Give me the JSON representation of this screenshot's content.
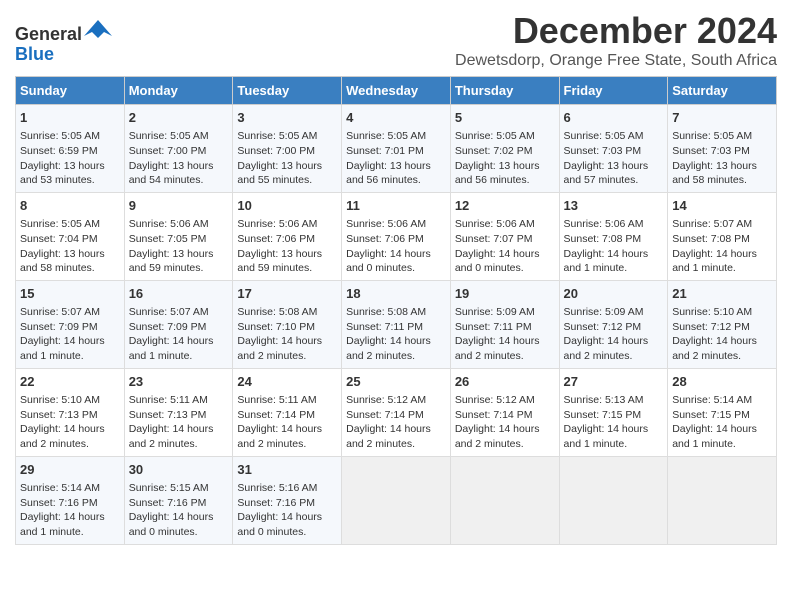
{
  "logo": {
    "line1": "General",
    "line2": "Blue"
  },
  "title": "December 2024",
  "location": "Dewetsdorp, Orange Free State, South Africa",
  "days_of_week": [
    "Sunday",
    "Monday",
    "Tuesday",
    "Wednesday",
    "Thursday",
    "Friday",
    "Saturday"
  ],
  "weeks": [
    [
      {
        "day": "1",
        "lines": [
          "Sunrise: 5:05 AM",
          "Sunset: 6:59 PM",
          "Daylight: 13 hours",
          "and 53 minutes."
        ]
      },
      {
        "day": "2",
        "lines": [
          "Sunrise: 5:05 AM",
          "Sunset: 7:00 PM",
          "Daylight: 13 hours",
          "and 54 minutes."
        ]
      },
      {
        "day": "3",
        "lines": [
          "Sunrise: 5:05 AM",
          "Sunset: 7:00 PM",
          "Daylight: 13 hours",
          "and 55 minutes."
        ]
      },
      {
        "day": "4",
        "lines": [
          "Sunrise: 5:05 AM",
          "Sunset: 7:01 PM",
          "Daylight: 13 hours",
          "and 56 minutes."
        ]
      },
      {
        "day": "5",
        "lines": [
          "Sunrise: 5:05 AM",
          "Sunset: 7:02 PM",
          "Daylight: 13 hours",
          "and 56 minutes."
        ]
      },
      {
        "day": "6",
        "lines": [
          "Sunrise: 5:05 AM",
          "Sunset: 7:03 PM",
          "Daylight: 13 hours",
          "and 57 minutes."
        ]
      },
      {
        "day": "7",
        "lines": [
          "Sunrise: 5:05 AM",
          "Sunset: 7:03 PM",
          "Daylight: 13 hours",
          "and 58 minutes."
        ]
      }
    ],
    [
      {
        "day": "8",
        "lines": [
          "Sunrise: 5:05 AM",
          "Sunset: 7:04 PM",
          "Daylight: 13 hours",
          "and 58 minutes."
        ]
      },
      {
        "day": "9",
        "lines": [
          "Sunrise: 5:06 AM",
          "Sunset: 7:05 PM",
          "Daylight: 13 hours",
          "and 59 minutes."
        ]
      },
      {
        "day": "10",
        "lines": [
          "Sunrise: 5:06 AM",
          "Sunset: 7:06 PM",
          "Daylight: 13 hours",
          "and 59 minutes."
        ]
      },
      {
        "day": "11",
        "lines": [
          "Sunrise: 5:06 AM",
          "Sunset: 7:06 PM",
          "Daylight: 14 hours",
          "and 0 minutes."
        ]
      },
      {
        "day": "12",
        "lines": [
          "Sunrise: 5:06 AM",
          "Sunset: 7:07 PM",
          "Daylight: 14 hours",
          "and 0 minutes."
        ]
      },
      {
        "day": "13",
        "lines": [
          "Sunrise: 5:06 AM",
          "Sunset: 7:08 PM",
          "Daylight: 14 hours",
          "and 1 minute."
        ]
      },
      {
        "day": "14",
        "lines": [
          "Sunrise: 5:07 AM",
          "Sunset: 7:08 PM",
          "Daylight: 14 hours",
          "and 1 minute."
        ]
      }
    ],
    [
      {
        "day": "15",
        "lines": [
          "Sunrise: 5:07 AM",
          "Sunset: 7:09 PM",
          "Daylight: 14 hours",
          "and 1 minute."
        ]
      },
      {
        "day": "16",
        "lines": [
          "Sunrise: 5:07 AM",
          "Sunset: 7:09 PM",
          "Daylight: 14 hours",
          "and 1 minute."
        ]
      },
      {
        "day": "17",
        "lines": [
          "Sunrise: 5:08 AM",
          "Sunset: 7:10 PM",
          "Daylight: 14 hours",
          "and 2 minutes."
        ]
      },
      {
        "day": "18",
        "lines": [
          "Sunrise: 5:08 AM",
          "Sunset: 7:11 PM",
          "Daylight: 14 hours",
          "and 2 minutes."
        ]
      },
      {
        "day": "19",
        "lines": [
          "Sunrise: 5:09 AM",
          "Sunset: 7:11 PM",
          "Daylight: 14 hours",
          "and 2 minutes."
        ]
      },
      {
        "day": "20",
        "lines": [
          "Sunrise: 5:09 AM",
          "Sunset: 7:12 PM",
          "Daylight: 14 hours",
          "and 2 minutes."
        ]
      },
      {
        "day": "21",
        "lines": [
          "Sunrise: 5:10 AM",
          "Sunset: 7:12 PM",
          "Daylight: 14 hours",
          "and 2 minutes."
        ]
      }
    ],
    [
      {
        "day": "22",
        "lines": [
          "Sunrise: 5:10 AM",
          "Sunset: 7:13 PM",
          "Daylight: 14 hours",
          "and 2 minutes."
        ]
      },
      {
        "day": "23",
        "lines": [
          "Sunrise: 5:11 AM",
          "Sunset: 7:13 PM",
          "Daylight: 14 hours",
          "and 2 minutes."
        ]
      },
      {
        "day": "24",
        "lines": [
          "Sunrise: 5:11 AM",
          "Sunset: 7:14 PM",
          "Daylight: 14 hours",
          "and 2 minutes."
        ]
      },
      {
        "day": "25",
        "lines": [
          "Sunrise: 5:12 AM",
          "Sunset: 7:14 PM",
          "Daylight: 14 hours",
          "and 2 minutes."
        ]
      },
      {
        "day": "26",
        "lines": [
          "Sunrise: 5:12 AM",
          "Sunset: 7:14 PM",
          "Daylight: 14 hours",
          "and 2 minutes."
        ]
      },
      {
        "day": "27",
        "lines": [
          "Sunrise: 5:13 AM",
          "Sunset: 7:15 PM",
          "Daylight: 14 hours",
          "and 1 minute."
        ]
      },
      {
        "day": "28",
        "lines": [
          "Sunrise: 5:14 AM",
          "Sunset: 7:15 PM",
          "Daylight: 14 hours",
          "and 1 minute."
        ]
      }
    ],
    [
      {
        "day": "29",
        "lines": [
          "Sunrise: 5:14 AM",
          "Sunset: 7:16 PM",
          "Daylight: 14 hours",
          "and 1 minute."
        ]
      },
      {
        "day": "30",
        "lines": [
          "Sunrise: 5:15 AM",
          "Sunset: 7:16 PM",
          "Daylight: 14 hours",
          "and 0 minutes."
        ]
      },
      {
        "day": "31",
        "lines": [
          "Sunrise: 5:16 AM",
          "Sunset: 7:16 PM",
          "Daylight: 14 hours",
          "and 0 minutes."
        ]
      },
      {
        "day": "",
        "lines": []
      },
      {
        "day": "",
        "lines": []
      },
      {
        "day": "",
        "lines": []
      },
      {
        "day": "",
        "lines": []
      }
    ]
  ]
}
